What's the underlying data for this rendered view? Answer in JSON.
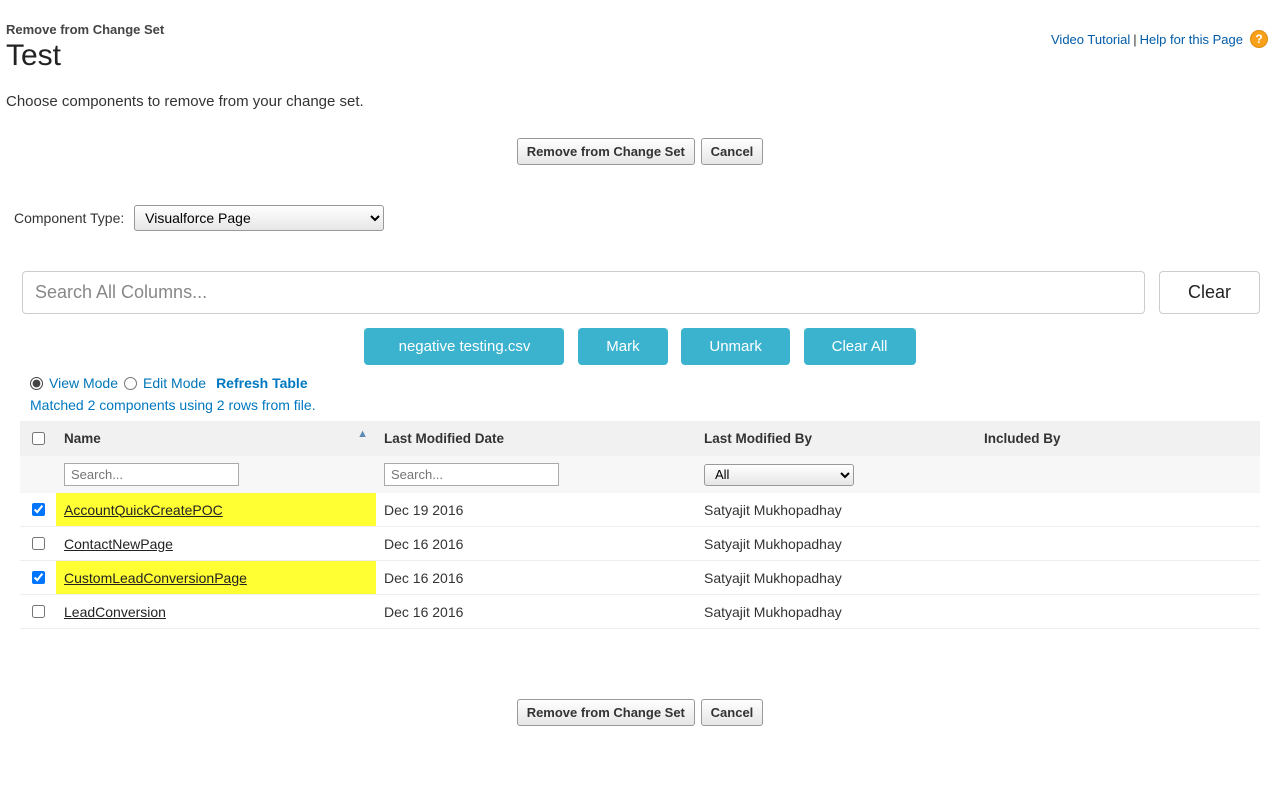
{
  "header": {
    "eyebrow": "Remove from Change Set",
    "title": "Test",
    "intro": "Choose components to remove from your change set.",
    "video_tutorial": "Video Tutorial",
    "help_for_page": "Help for this Page"
  },
  "actions": {
    "remove": "Remove from Change Set",
    "cancel": "Cancel"
  },
  "component_type": {
    "label": "Component Type:",
    "value": "Visualforce Page"
  },
  "search": {
    "placeholder": "Search All Columns...",
    "clear": "Clear"
  },
  "cyan": {
    "file": "negative testing.csv",
    "mark": "Mark",
    "unmark": "Unmark",
    "clear_all": "Clear All"
  },
  "mode": {
    "view": "View Mode",
    "edit": "Edit Mode",
    "refresh": "Refresh Table",
    "matched": "Matched 2 components using 2 rows from file."
  },
  "table": {
    "columns": {
      "name": "Name",
      "last_modified_date": "Last Modified Date",
      "last_modified_by": "Last Modified By",
      "included_by": "Included By"
    },
    "filter": {
      "name_placeholder": "Search...",
      "date_placeholder": "Search...",
      "by_value": "All"
    },
    "rows": [
      {
        "checked": true,
        "highlight": true,
        "name": "AccountQuickCreatePOC",
        "date": "Dec 19 2016",
        "by": "Satyajit Mukhopadhay",
        "incl": ""
      },
      {
        "checked": false,
        "highlight": false,
        "name": "ContactNewPage",
        "date": "Dec 16 2016",
        "by": "Satyajit Mukhopadhay",
        "incl": ""
      },
      {
        "checked": true,
        "highlight": true,
        "name": "CustomLeadConversionPage",
        "date": "Dec 16 2016",
        "by": "Satyajit Mukhopadhay",
        "incl": ""
      },
      {
        "checked": false,
        "highlight": false,
        "name": "LeadConversion",
        "date": "Dec 16 2016",
        "by": "Satyajit Mukhopadhay",
        "incl": ""
      }
    ]
  }
}
